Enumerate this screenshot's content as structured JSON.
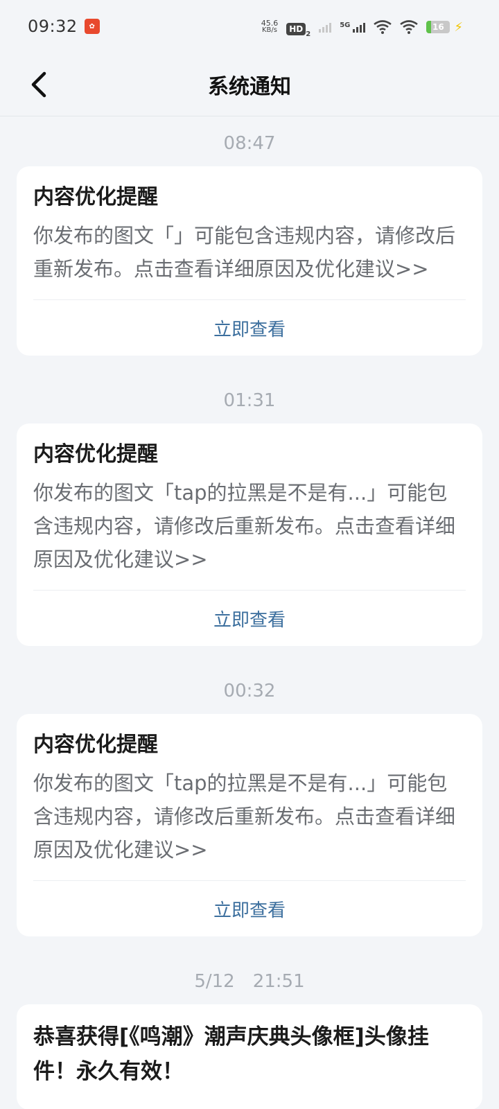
{
  "status_bar": {
    "time": "09:32",
    "app_badge_icon": "app-notification-icon",
    "net_speed_value": "45.6",
    "net_speed_unit": "KB/s",
    "hd_label": "HD",
    "hd_sub": "2",
    "five_g_label": "5G",
    "battery_level": "16",
    "charging_color": "#f2c500"
  },
  "navbar": {
    "title": "系统通知",
    "back_icon": "chevron-left-icon"
  },
  "notifications": [
    {
      "time": "08:47",
      "title": "内容优化提醒",
      "body": "你发布的图文「」可能包含违规内容，请修改后重新发布。点击查看详细原因及优化建议>>",
      "action": "立即查看"
    },
    {
      "time": "01:31",
      "title": "内容优化提醒",
      "body": "你发布的图文「tap的拉黑是不是有...」可能包含违规内容，请修改后重新发布。点击查看详细原因及优化建议>>",
      "action": "立即查看"
    },
    {
      "time": "00:32",
      "title": "内容优化提醒",
      "body": "你发布的图文「tap的拉黑是不是有...」可能包含违规内容，请修改后重新发布。点击查看详细原因及优化建议>>",
      "action": "立即查看"
    },
    {
      "time": "5/12　21:51",
      "title": "恭喜获得[《鸣潮》潮声庆典头像框]头像挂件！永久有效！"
    }
  ],
  "colors": {
    "background": "#f3f5f8",
    "card": "#ffffff",
    "action_link": "#3c6f9e",
    "timestamp": "#a6abb2"
  }
}
